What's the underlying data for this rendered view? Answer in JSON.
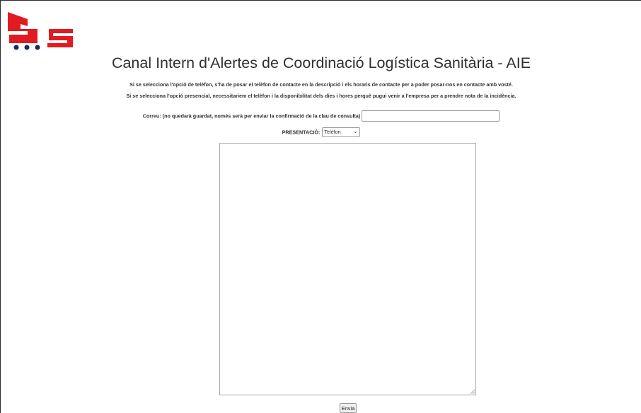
{
  "logo": {
    "icon": "sls-truck-logo",
    "colors": {
      "red": "#e11b22",
      "navy": "#1c2a5a"
    }
  },
  "header": {
    "title": "Canal Intern d'Alertes de Coordinació Logística Sanitària - AIE"
  },
  "notes": [
    "Si se selecciona l'opció de telèfon, s'ha de posar el telèfon de contacte en la descripció i els horaris de contacte per a poder posar-nos en contacte amb vosté.",
    "Si se selecciona l'opció presencial, necessitariem el telèfon i la disponibilitat dels dies i hores perquè pugui venir a l'empresa per a prendre nota de la incidència."
  ],
  "form": {
    "email_label": "Correu: (no quedarà guardat, només serà per enviar la confirmació de la clau de consulta)",
    "email_value": "",
    "presentation_label": "PRESENTACIÓ:",
    "presentation_selected": "Telèfon",
    "description_value": "",
    "submit_label": "Envia"
  }
}
